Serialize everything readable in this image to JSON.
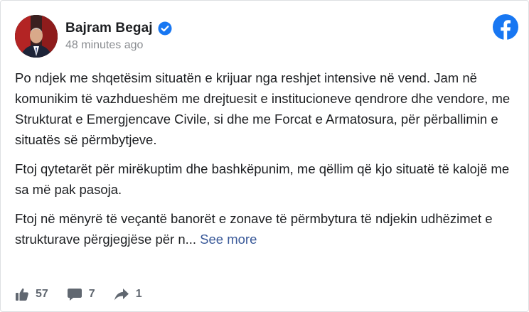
{
  "post": {
    "author": "Bajram Begaj",
    "timestamp": "48 minutes ago",
    "paragraphs": [
      "Po ndjek me shqetësim situatën e krijuar nga reshjet intensive në vend. Jam në komunikim të vazhdueshëm me drejtuesit e institucioneve qendrore dhe vendore, me Strukturat e Emergjencave Civile, si dhe me Forcat e Armatosura, për përballimin e situatës së përmbytjeve.",
      "Ftoj qytetarët për mirëkuptim dhe bashkëpunim, me qëllim që kjo situatë të kalojë me sa më pak pasoja.",
      "Ftoj në mënyrë të veçantë banorët e zonave të përmbytura të ndjekin udhëzimet e strukturave përgjegjëse për n..."
    ],
    "see_more": "See more"
  },
  "stats": {
    "likes": "57",
    "comments": "7",
    "shares": "1"
  },
  "icons": {
    "verified": "verified-badge-icon",
    "platform": "facebook-logo-icon",
    "like": "thumbs-up-icon",
    "comment": "comment-icon",
    "share": "share-arrow-icon"
  },
  "colors": {
    "facebook_blue": "#1877f2",
    "link": "#385898",
    "text": "#1c1e21",
    "muted": "#8a8d91"
  }
}
